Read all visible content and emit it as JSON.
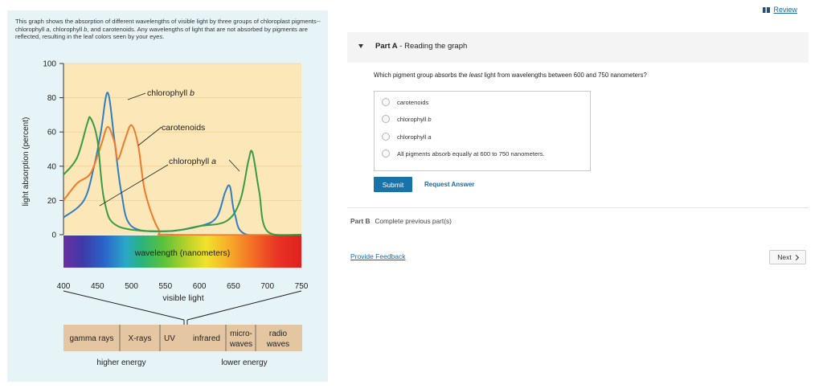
{
  "header": {
    "review_label": "Review"
  },
  "intro": {
    "part1": "This graph shows the absorption of different wavelengths of visible light by three groups of chloroplast pigments--chlorophyll ",
    "chl_a": "a",
    "part2": ", chlorophyll ",
    "chl_b": "b",
    "part3": ", and carotenoids. Any wavelengths of light that are not absorbed by pigments are reflected, resulting in the leaf colors seen by your eyes."
  },
  "figure": {
    "ylabel": "light absorption (percent)",
    "yticks": [
      "100",
      "80",
      "60",
      "40",
      "20",
      "0"
    ],
    "xticks": [
      "400",
      "450",
      "500",
      "550",
      "600",
      "650",
      "700",
      "750"
    ],
    "spectrum_label": "wavelength (nanometers)",
    "visible_label": "visible light",
    "curve_labels": {
      "chl_b": "chlorophyll ",
      "chl_b_letter": "b",
      "carot": "carotenoids",
      "chl_a": "chlorophyll ",
      "chl_a_letter": "a"
    },
    "em_spectrum": [
      "gamma rays",
      "X-rays",
      "UV",
      "infrared",
      "micro-",
      "waves",
      "radio",
      "waves"
    ],
    "higher_energy": "higher energy",
    "lower_energy": "lower energy",
    "colors": {
      "chl_a": "#3a9a45",
      "chl_b": "#2f7fc2",
      "carotenoids": "#f07a2c",
      "plot_bg": "#fbe7b7"
    }
  },
  "chart_data": {
    "type": "line",
    "xlabel": "wavelength (nanometers)",
    "ylabel": "light absorption (percent)",
    "xlim": [
      400,
      750
    ],
    "ylim": [
      0,
      100
    ],
    "series": [
      {
        "name": "chlorophyll b",
        "points": [
          [
            400,
            10
          ],
          [
            430,
            20
          ],
          [
            445,
            40
          ],
          [
            455,
            60
          ],
          [
            465,
            83
          ],
          [
            475,
            55
          ],
          [
            485,
            25
          ],
          [
            500,
            5
          ],
          [
            550,
            2
          ],
          [
            600,
            5
          ],
          [
            625,
            10
          ],
          [
            638,
            25
          ],
          [
            645,
            28
          ],
          [
            652,
            12
          ],
          [
            670,
            0
          ],
          [
            750,
            0
          ]
        ]
      },
      {
        "name": "carotenoids",
        "points": [
          [
            400,
            20
          ],
          [
            420,
            30
          ],
          [
            440,
            36
          ],
          [
            455,
            52
          ],
          [
            465,
            63
          ],
          [
            475,
            54
          ],
          [
            480,
            44
          ],
          [
            490,
            55
          ],
          [
            500,
            64
          ],
          [
            510,
            52
          ],
          [
            520,
            25
          ],
          [
            540,
            3
          ],
          [
            560,
            0
          ],
          [
            750,
            0
          ]
        ]
      },
      {
        "name": "chlorophyll a",
        "points": [
          [
            400,
            35
          ],
          [
            420,
            45
          ],
          [
            435,
            65
          ],
          [
            440,
            68
          ],
          [
            450,
            55
          ],
          [
            460,
            20
          ],
          [
            480,
            5
          ],
          [
            550,
            2
          ],
          [
            600,
            5
          ],
          [
            640,
            8
          ],
          [
            660,
            20
          ],
          [
            672,
            43
          ],
          [
            678,
            48
          ],
          [
            688,
            25
          ],
          [
            700,
            2
          ],
          [
            750,
            0
          ]
        ]
      }
    ]
  },
  "partA": {
    "title_prefix": "Part A",
    "title_text": "Reading the graph",
    "question_pre": "Which pigment group absorbs the ",
    "question_em": "least",
    "question_post": " light from wavelengths between 600 and 750 nanometers?",
    "options": [
      "carotenoids",
      "chlorophyll b",
      "chlorophyll a",
      "All pigments absorb equally at 600 to 750 nanometers."
    ],
    "submit_label": "Submit",
    "request_label": "Request Answer"
  },
  "partB": {
    "prefix": "Part B",
    "text": "Complete previous part(s)"
  },
  "footer": {
    "feedback_label": "Provide Feedback",
    "next_label": "Next"
  }
}
